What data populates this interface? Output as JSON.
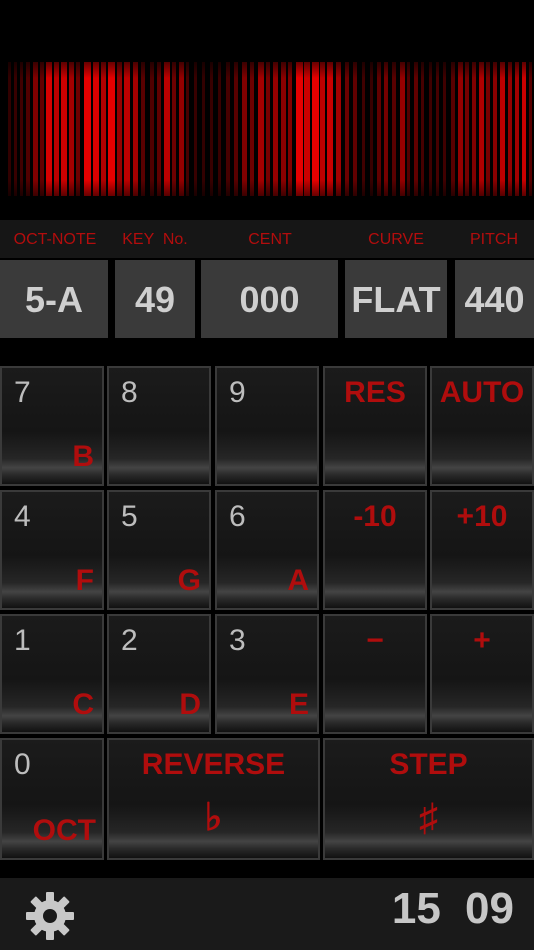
{
  "labels": {
    "oct_note": "OCT-NOTE",
    "key_no": "KEY  No.",
    "cent": "CENT",
    "curve": "CURVE",
    "pitch": "PITCH"
  },
  "readouts": {
    "oct_note": "5-A",
    "key_no": "49",
    "cent": "000",
    "curve": "FLAT",
    "pitch": "440"
  },
  "keypad": {
    "k7": {
      "num": "7",
      "note": "B"
    },
    "k8": {
      "num": "8"
    },
    "k9": {
      "num": "9"
    },
    "res": "RES",
    "auto": "AUTO",
    "k4": {
      "num": "4",
      "note": "F"
    },
    "k5": {
      "num": "5",
      "note": "G"
    },
    "k6": {
      "num": "6",
      "note": "A"
    },
    "minus10": "-10",
    "plus10": "+10",
    "k1": {
      "num": "1",
      "note": "C"
    },
    "k2": {
      "num": "2",
      "note": "D"
    },
    "k3": {
      "num": "3",
      "note": "E"
    },
    "minus": "−",
    "plus": "+",
    "k0": {
      "num": "0",
      "note": "OCT"
    },
    "reverse": {
      "label": "REVERSE",
      "symbol": "♭"
    },
    "step": {
      "label": "STEP",
      "symbol": "♯"
    }
  },
  "status": {
    "time": "15 09"
  },
  "colors": {
    "accent": "#b00d0d",
    "text": "#cfcfcf"
  }
}
